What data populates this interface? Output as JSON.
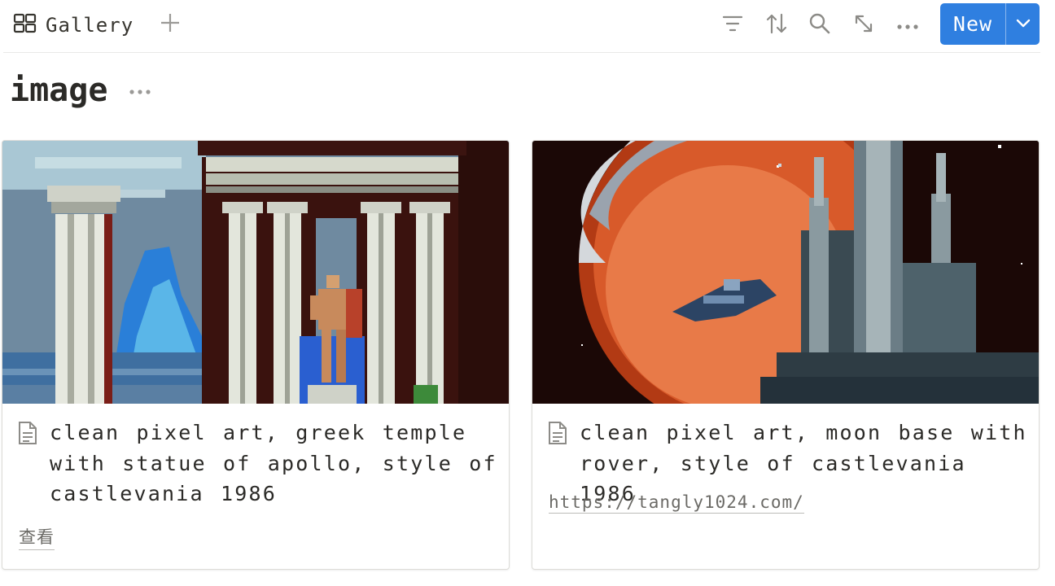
{
  "toolbar": {
    "view_tab_label": "Gallery",
    "view_tab_icon": "gallery-grid-icon",
    "add_view_icon": "plus-icon",
    "tools": [
      "filter-icon",
      "sort-icon",
      "search-icon",
      "expand-icon",
      "more-icon"
    ],
    "new_button_label": "New",
    "new_button_dropdown_icon": "chevron-down-icon",
    "accent_color": "#2f7fe0"
  },
  "page": {
    "title": "image",
    "title_more_icon": "more-icon"
  },
  "cards": [
    {
      "title": "clean pixel art, greek temple with statue of apollo, style of castlevania 1986",
      "property": "查看",
      "icon": "document-icon",
      "cover": "pixel-art-greek-temple-apollo"
    },
    {
      "title": "clean pixel art, moon base with rover, style of castlevania 1986",
      "property": "https://tangly1024.com/",
      "icon": "document-icon",
      "cover": "pixel-art-moon-base"
    }
  ]
}
